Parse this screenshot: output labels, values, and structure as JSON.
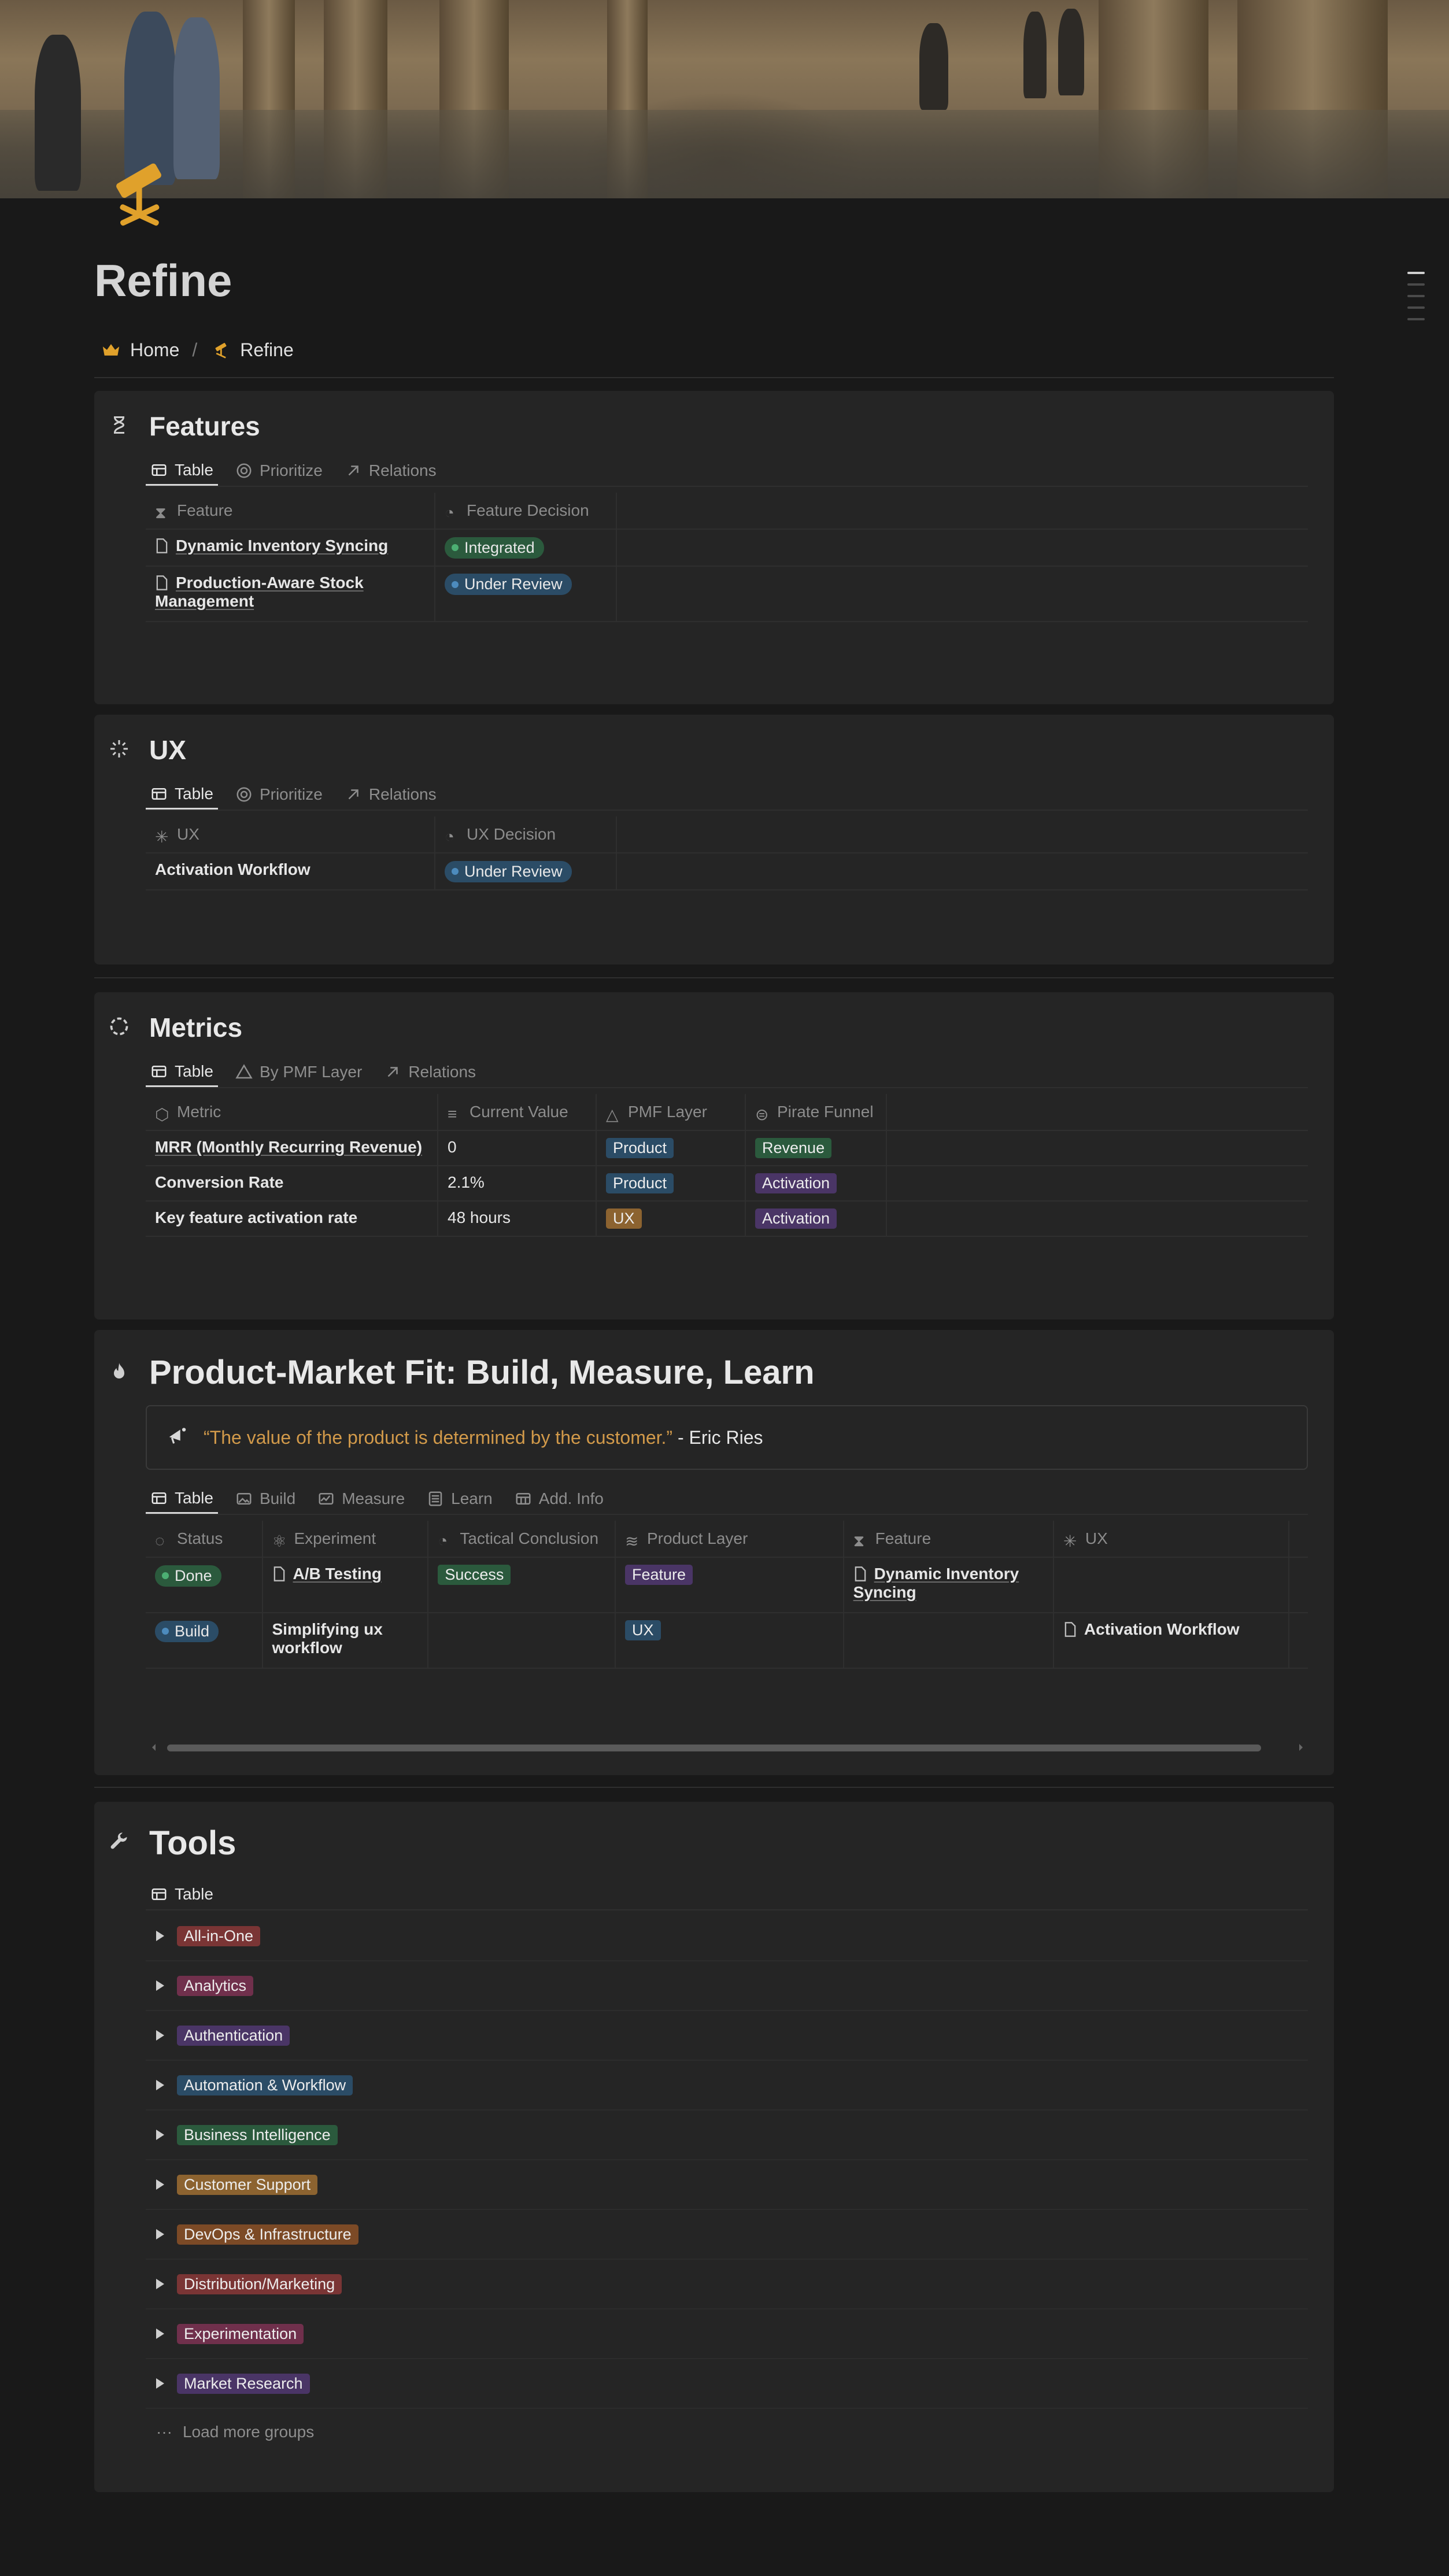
{
  "page": {
    "title": "Refine",
    "breadcrumb": [
      {
        "label": "Home",
        "icon": "crown-icon"
      },
      {
        "label": "Refine",
        "icon": "telescope-icon"
      }
    ],
    "breadcrumb_sep": "/"
  },
  "colors": {
    "accent": "#e0a12b",
    "green": "#2b5a3d",
    "blue": "#2b4c66",
    "purple": "#4a3566",
    "orange": "#8c6330",
    "red": "#7a3535",
    "pink": "#70304c"
  },
  "features": {
    "title": "Features",
    "tabs": [
      "Table",
      "Prioritize",
      "Relations"
    ],
    "columns": [
      "Feature",
      "Feature Decision"
    ],
    "rows": [
      {
        "name": "Dynamic Inventory Syncing",
        "decision": "Integrated"
      },
      {
        "name": "Production-Aware Stock Management",
        "decision": "Under Review"
      }
    ]
  },
  "ux": {
    "title": "UX",
    "tabs": [
      "Table",
      "Prioritize",
      "Relations"
    ],
    "columns": [
      "UX",
      "UX Decision"
    ],
    "rows": [
      {
        "name": "Activation Workflow",
        "decision": "Under Review"
      }
    ]
  },
  "metrics": {
    "title": "Metrics",
    "tabs": [
      "Table",
      "By PMF Layer",
      "Relations"
    ],
    "columns": [
      "Metric",
      "Current Value",
      "PMF Layer",
      "Pirate Funnel"
    ],
    "rows": [
      {
        "metric": "MRR (Monthly Recurring Revenue)",
        "value": "0",
        "layer": "Product",
        "funnel": "Revenue"
      },
      {
        "metric": "Conversion Rate",
        "value": "2.1%",
        "layer": "Product",
        "funnel": "Activation"
      },
      {
        "metric": "Key feature activation rate",
        "value": "48 hours",
        "layer": "UX",
        "funnel": "Activation"
      }
    ]
  },
  "pmf": {
    "title": "Product-Market Fit: Build, Measure, Learn",
    "quote": "“The value of the product is determined by the customer.”",
    "quote_author": "- Eric Ries",
    "tabs": [
      "Table",
      "Build",
      "Measure",
      "Learn",
      "Add. Info"
    ],
    "columns": [
      "Status",
      "Experiment",
      "Tactical Conclusion",
      "Product Layer",
      "Feature",
      "UX"
    ],
    "rows": [
      {
        "status": "Done",
        "experiment": "A/B Testing",
        "conclusion": "Success",
        "layer": "Feature",
        "feature": "Dynamic Inventory Syncing",
        "ux": ""
      },
      {
        "status": "Build",
        "experiment": "Simplifying ux workflow",
        "conclusion": "",
        "layer": "UX",
        "feature": "",
        "ux": "Activation Workflow"
      }
    ]
  },
  "tools": {
    "title": "Tools",
    "view": "Table",
    "groups": [
      "All-in-One",
      "Analytics",
      "Authentication",
      "Automation & Workflow",
      "Business Intelligence",
      "Customer Support",
      "DevOps & Infrastructure",
      "Distribution/Marketing",
      "Experimentation",
      "Market Research"
    ],
    "load_more": "Load more groups"
  }
}
